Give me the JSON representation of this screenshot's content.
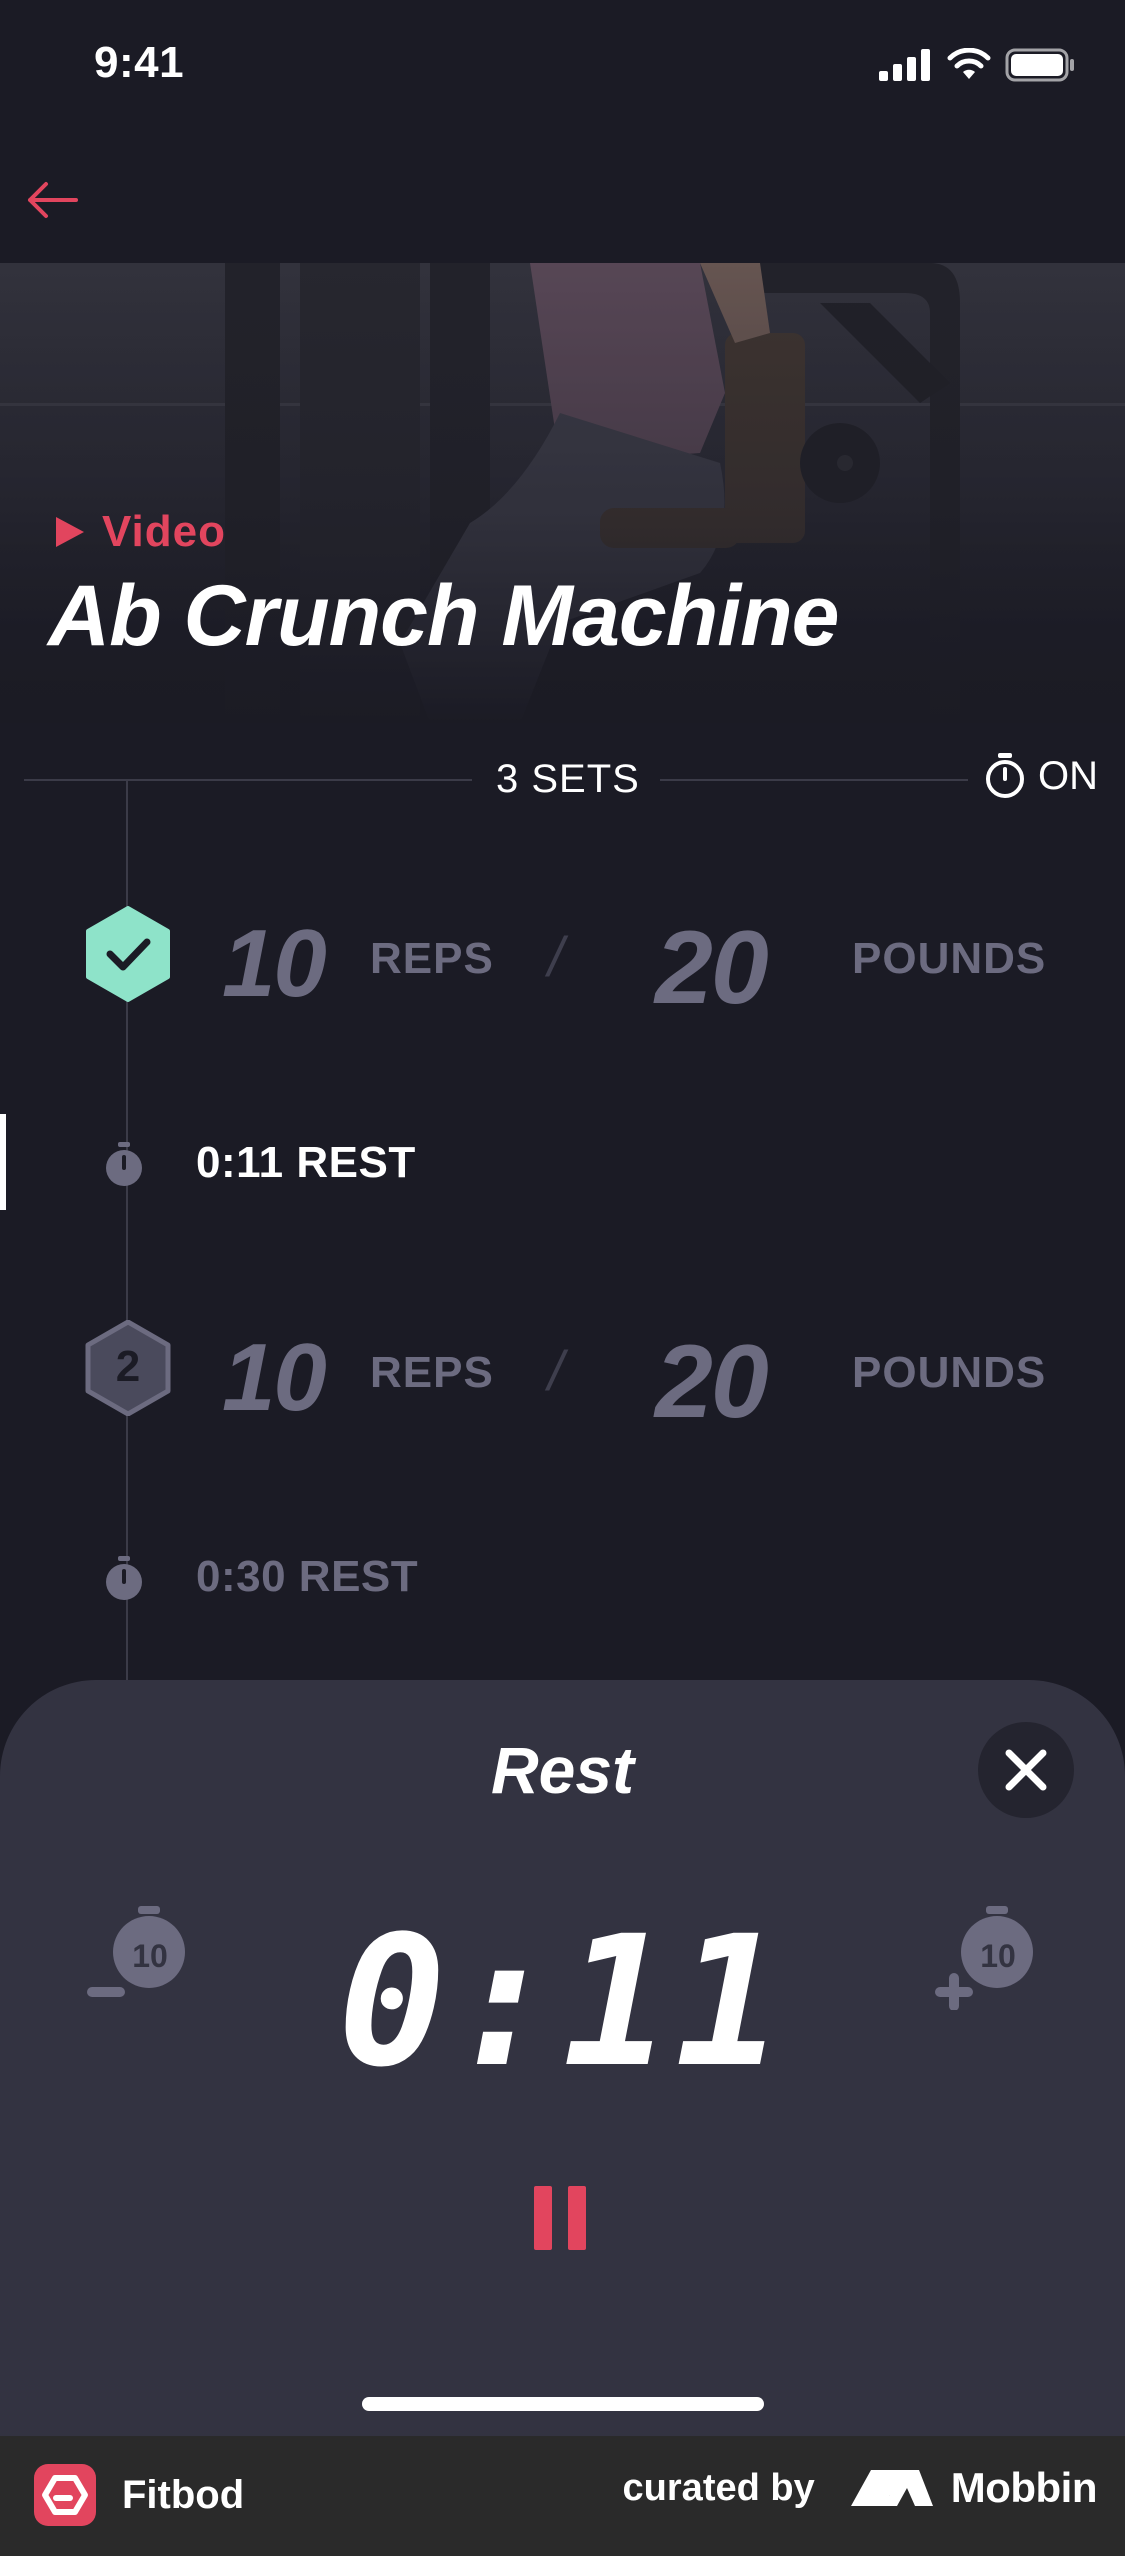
{
  "status_bar": {
    "time": "9:41"
  },
  "hero": {
    "video_label": "Video",
    "title": "Ab Crunch Machine"
  },
  "sets_header": {
    "count_label": "3 SETS",
    "timer_label": "ON"
  },
  "sets": [
    {
      "badge": "",
      "completed": true,
      "reps": "10",
      "reps_unit": "REPS",
      "separator": "/",
      "weight": "20",
      "weight_unit": "POUNDS"
    },
    {
      "badge": "2",
      "completed": false,
      "reps": "10",
      "reps_unit": "REPS",
      "separator": "/",
      "weight": "20",
      "weight_unit": "POUNDS"
    }
  ],
  "rests": [
    {
      "label": "0:11 REST",
      "active": true
    },
    {
      "label": "0:30 REST",
      "active": false
    }
  ],
  "rest_sheet": {
    "title": "Rest",
    "timer": "0:11",
    "decrease_seconds": "10",
    "increase_seconds": "10"
  },
  "footer": {
    "app_name": "Fitbod",
    "curated_by": "curated by",
    "brand": "Mobbin"
  },
  "colors": {
    "accent": "#e2455e",
    "complete": "#8ee3c9",
    "muted": "#6c6b80",
    "background": "#1b1b25",
    "sheet": "#333341"
  }
}
